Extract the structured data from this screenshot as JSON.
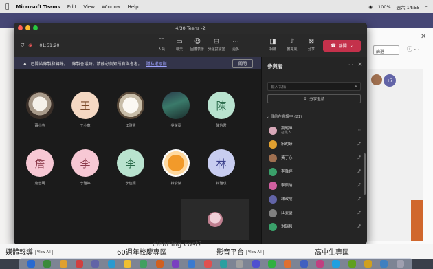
{
  "menubar": {
    "app": "Microsoft Teams",
    "menus": [
      "Edit",
      "View",
      "Window",
      "Help"
    ],
    "battery": "100%",
    "clock": "週六 14:55"
  },
  "background": {
    "filter_label": "篩選",
    "bottom_texts": [
      "媒體報導",
      "60週年校慶專區",
      "cleaning cost?",
      "影音平台",
      "高中生專區"
    ],
    "tag": "View All",
    "badge": "+7"
  },
  "meeting": {
    "window_title": "4/30 Teens -2",
    "timer": "01:51:20",
    "toolbar": [
      {
        "icon": "people-icon",
        "label": "人員"
      },
      {
        "icon": "chat-icon",
        "label": "聊天"
      },
      {
        "icon": "reactions-icon",
        "label": "回應表示"
      },
      {
        "icon": "rooms-icon",
        "label": "分組討論室"
      },
      {
        "icon": "more-icon",
        "label": "更多"
      },
      {
        "icon": "camera-icon",
        "label": "相機"
      },
      {
        "icon": "mic-icon",
        "label": "麥克風"
      },
      {
        "icon": "share-icon",
        "label": "分享"
      }
    ],
    "leave_label": "離開",
    "banner": {
      "text": "已開始錄製和轉錄。",
      "text2": "錄製會議時，請務必告知所有與會者。",
      "link": "隱私權原則",
      "close": "關閉"
    },
    "tiles": [
      {
        "name": "蘇小芬",
        "initial": "",
        "bg": "#6b5a4a",
        "photo": "cat"
      },
      {
        "name": "王小華",
        "initial": "王",
        "bg": "#f4d8c3",
        "fg": "#7a4a2a"
      },
      {
        "name": "江雅慧",
        "initial": "",
        "bg": "#8a7a6a",
        "photo": "dog"
      },
      {
        "name": "吳家豪",
        "initial": "",
        "bg": "#4a6a5a",
        "photo": "scene"
      },
      {
        "name": "陳怡君",
        "initial": "陳",
        "bg": "#b9e3cf",
        "fg": "#2a6a4a"
      },
      {
        "name": "詹志明",
        "initial": "詹",
        "bg": "#f7c8d4",
        "fg": "#8a3a4a"
      },
      {
        "name": "李雅婷",
        "initial": "李",
        "bg": "#f7c8d4",
        "fg": "#8a3a4a"
      },
      {
        "name": "李佳穎",
        "initial": "李",
        "bg": "#b9e3cf",
        "fg": "#2a6a4a"
      },
      {
        "name": "林俊傑",
        "initial": "",
        "bg": "#e89a3a",
        "photo": "duck"
      },
      {
        "name": "林雅琪",
        "initial": "林",
        "bg": "#c8cdf0",
        "fg": "#3a3f8a"
      }
    ],
    "participants": {
      "title": "參與者",
      "search_placeholder": "輸入名稱",
      "share_label": "分享邀請",
      "section": "目前在會議中 (21)",
      "list": [
        {
          "name": "劉昭瑋",
          "sub": "召集人",
          "bg": "#d8a8b8"
        },
        {
          "name": "宋昀臻",
          "bg": "#e0a030"
        },
        {
          "name": "黃丁心",
          "bg": "#a07050"
        },
        {
          "name": "李雅婷",
          "bg": "#3aa06a"
        },
        {
          "name": "李佩瑜",
          "bg": "#d060a0"
        },
        {
          "name": "林政成",
          "bg": "#6264a7"
        },
        {
          "name": "江姿瑩",
          "bg": "#808080"
        },
        {
          "name": "洪瑞和",
          "bg": "#3aa06a"
        }
      ]
    }
  }
}
